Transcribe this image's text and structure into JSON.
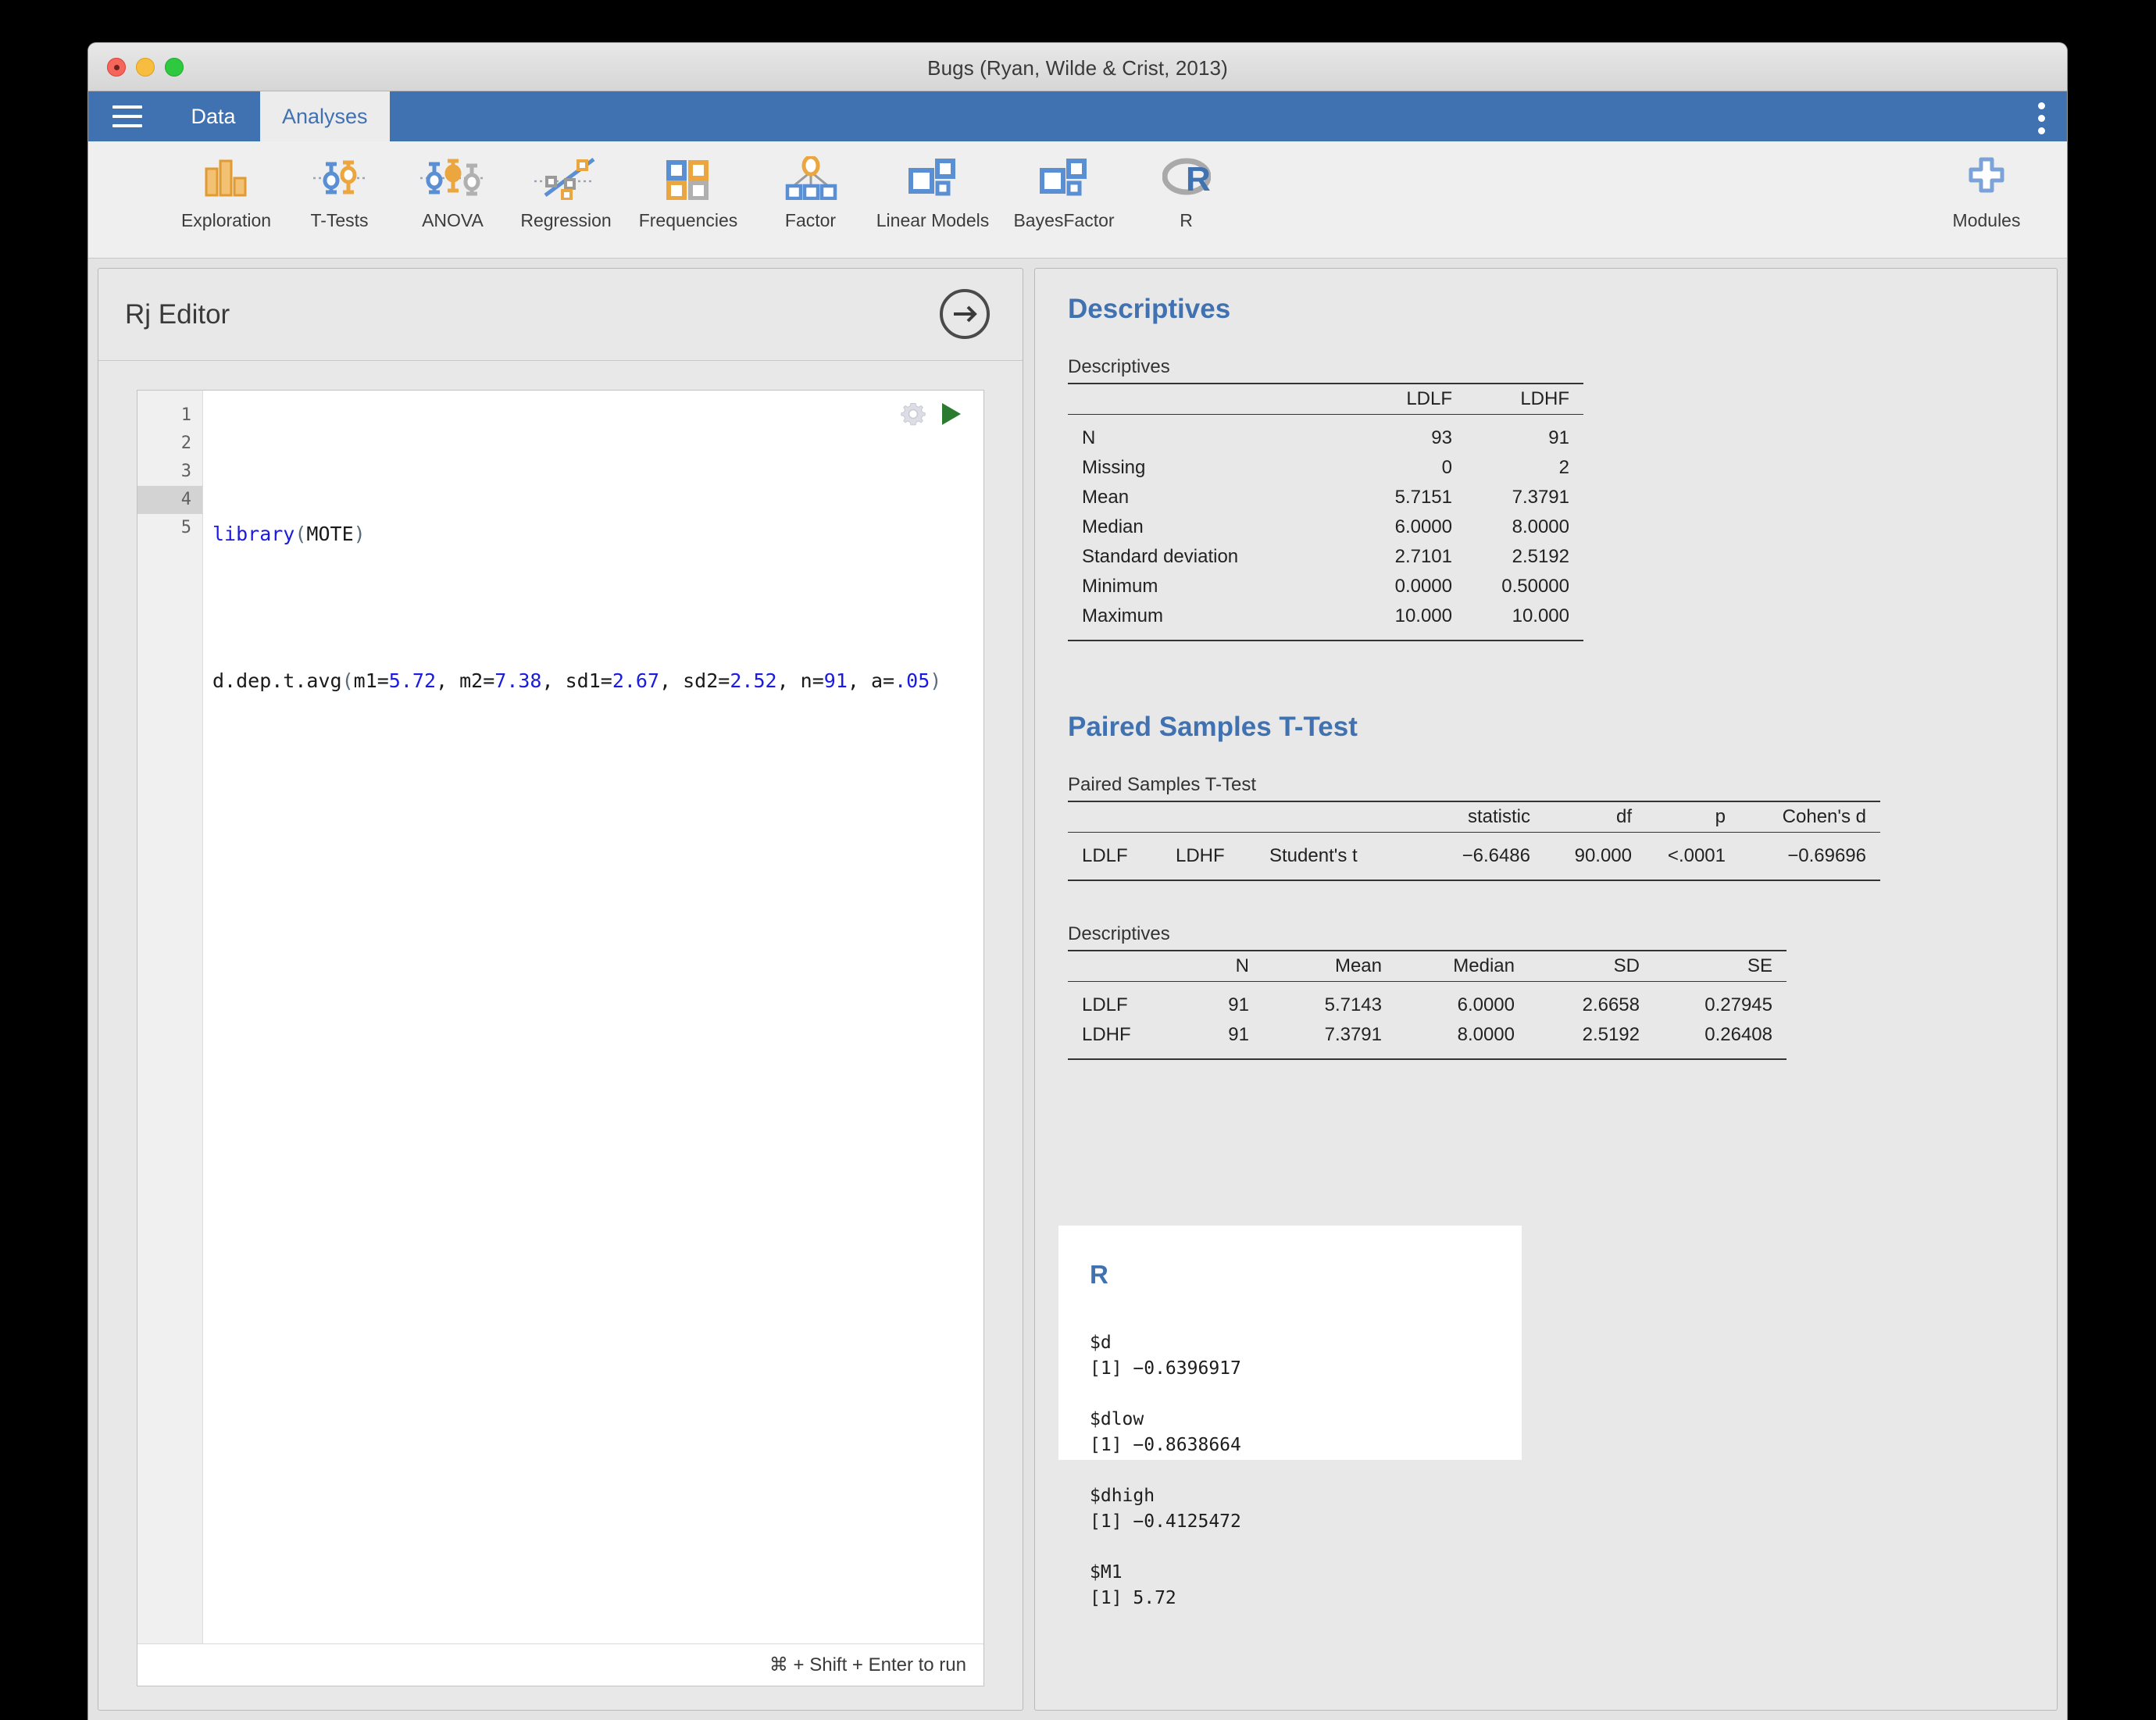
{
  "window": {
    "title": "Bugs (Ryan, Wilde & Crist, 2013)"
  },
  "tabs": [
    {
      "label": "Data",
      "active": false
    },
    {
      "label": "Analyses",
      "active": true
    }
  ],
  "ribbon": {
    "items": [
      {
        "label": "Exploration",
        "icon": "bar-chart-icon"
      },
      {
        "label": "T-Tests",
        "icon": "t-test-icon"
      },
      {
        "label": "ANOVA",
        "icon": "anova-icon"
      },
      {
        "label": "Regression",
        "icon": "regression-icon"
      },
      {
        "label": "Frequencies",
        "icon": "frequencies-icon"
      },
      {
        "label": "Factor",
        "icon": "factor-icon"
      },
      {
        "label": "Linear Models",
        "icon": "linear-models-icon"
      },
      {
        "label": "BayesFactor",
        "icon": "bayes-factor-icon"
      },
      {
        "label": "R",
        "icon": "r-logo-icon"
      }
    ],
    "modules": {
      "label": "Modules",
      "icon": "plus-icon"
    }
  },
  "editor": {
    "title": "Rj Editor",
    "line_numbers": [
      "1",
      "2",
      "3",
      "4",
      "5"
    ],
    "active_line": 4,
    "code_lines": [
      "",
      "library(MOTE)",
      "",
      "d.dep.t.avg(m1=5.72, m2=7.38, sd1=2.67, sd2=2.52, n=91, a=.05)",
      ""
    ],
    "run_hint": "⌘ + Shift + Enter to run"
  },
  "results": {
    "descriptives": {
      "heading": "Descriptives",
      "caption": "Descriptives",
      "columns": [
        "",
        "LDLF",
        "LDHF"
      ],
      "rows": [
        {
          "label": "N",
          "ldlf": "93",
          "ldhf": "91"
        },
        {
          "label": "Missing",
          "ldlf": "0",
          "ldhf": "2"
        },
        {
          "label": "Mean",
          "ldlf": "5.7151",
          "ldhf": "7.3791"
        },
        {
          "label": "Median",
          "ldlf": "6.0000",
          "ldhf": "8.0000"
        },
        {
          "label": "Standard deviation",
          "ldlf": "2.7101",
          "ldhf": "2.5192"
        },
        {
          "label": "Minimum",
          "ldlf": "0.0000",
          "ldhf": "0.50000"
        },
        {
          "label": "Maximum",
          "ldlf": "10.000",
          "ldhf": "10.000"
        }
      ]
    },
    "ttest": {
      "heading": "Paired Samples T-Test",
      "caption": "Paired Samples T-Test",
      "columns": [
        "",
        "",
        "",
        "statistic",
        "df",
        "p",
        "Cohen's d"
      ],
      "rows": [
        {
          "var1": "LDLF",
          "var2": "LDHF",
          "test": "Student's t",
          "statistic": "−6.6486",
          "df": "90.000",
          "p": "<.0001",
          "d": "−0.69696"
        }
      ]
    },
    "ttest_descriptives": {
      "caption": "Descriptives",
      "columns": [
        "",
        "N",
        "Mean",
        "Median",
        "SD",
        "SE"
      ],
      "rows": [
        {
          "label": "LDLF",
          "n": "91",
          "mean": "5.7143",
          "median": "6.0000",
          "sd": "2.6658",
          "se": "0.27945"
        },
        {
          "label": "LDHF",
          "n": "91",
          "mean": "7.3791",
          "median": "8.0000",
          "sd": "2.5192",
          "se": "0.26408"
        }
      ]
    },
    "r_output": {
      "heading": "R",
      "text": "$d\n[1] −0.6396917\n\n$dlow\n[1] −0.8638664\n\n$dhigh\n[1] −0.4125472\n\n$M1\n[1] 5.72"
    }
  },
  "colors": {
    "accent_blue": "#4071b0",
    "ribbon_bg": "#efefef",
    "panel_bg": "#e8e8e8",
    "icon_orange": "#eba63f",
    "icon_blue": "#5b8fd4",
    "icon_gray": "#a8a8a8",
    "run_green": "#2a7a2f",
    "code_blue": "#1a1ae0"
  }
}
